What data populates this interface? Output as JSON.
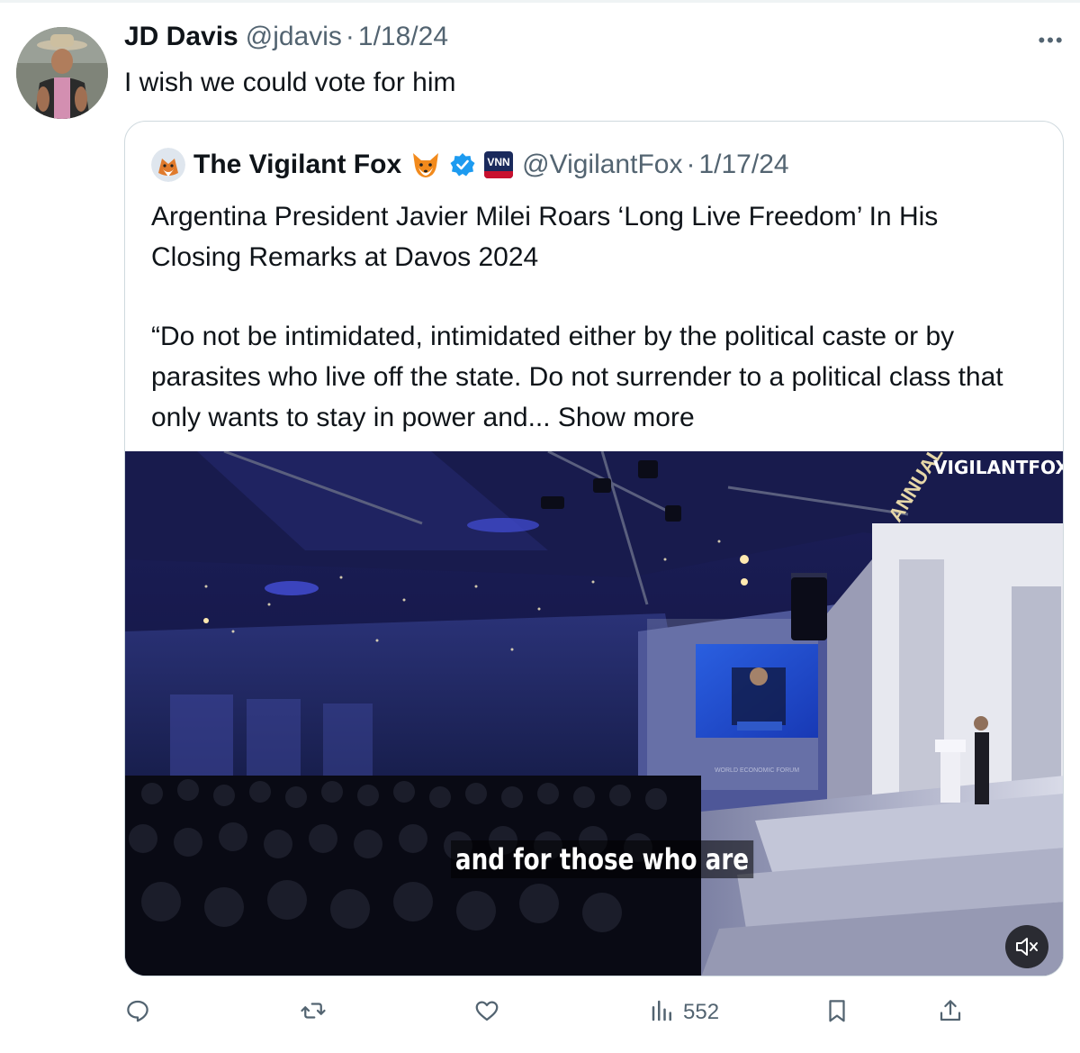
{
  "tweet": {
    "author_name": "JD Davis",
    "handle": "@jdavis",
    "separator": "·",
    "date": "1/18/24",
    "text": "I wish we could vote for him",
    "more_label": "•••"
  },
  "quoted": {
    "author_name": "The Vigilant Fox",
    "handle": "@VigilantFox",
    "separator": "·",
    "date": "1/17/24",
    "badge_text": "VNN",
    "title": "Argentina President Javier Milei Roars ‘Long Live Freedom’ In His Closing Remarks at Davos 2024",
    "body": "“Do not be intimidated, intimidated either by the political caste or by parasites who live off the state. Do not surrender to a political class that only wants to stay in power and...",
    "show_more": "Show more",
    "media": {
      "caption": "and for those who are",
      "watermark": "VIGILANTFOX",
      "signage_annual": "ANNUAL",
      "signage_forum": "WORLD ECONOMIC FORUM"
    }
  },
  "actions": {
    "views": "552"
  },
  "icons": [
    "reply-icon",
    "retweet-icon",
    "like-icon",
    "views-icon",
    "bookmark-icon",
    "share-icon",
    "mute-icon",
    "verified-icon",
    "fox-emoji-icon",
    "more-icon"
  ],
  "colors": {
    "text": "#0f1419",
    "muted": "#536471",
    "border": "#cfd9de",
    "verified": "#1d9bf0"
  }
}
